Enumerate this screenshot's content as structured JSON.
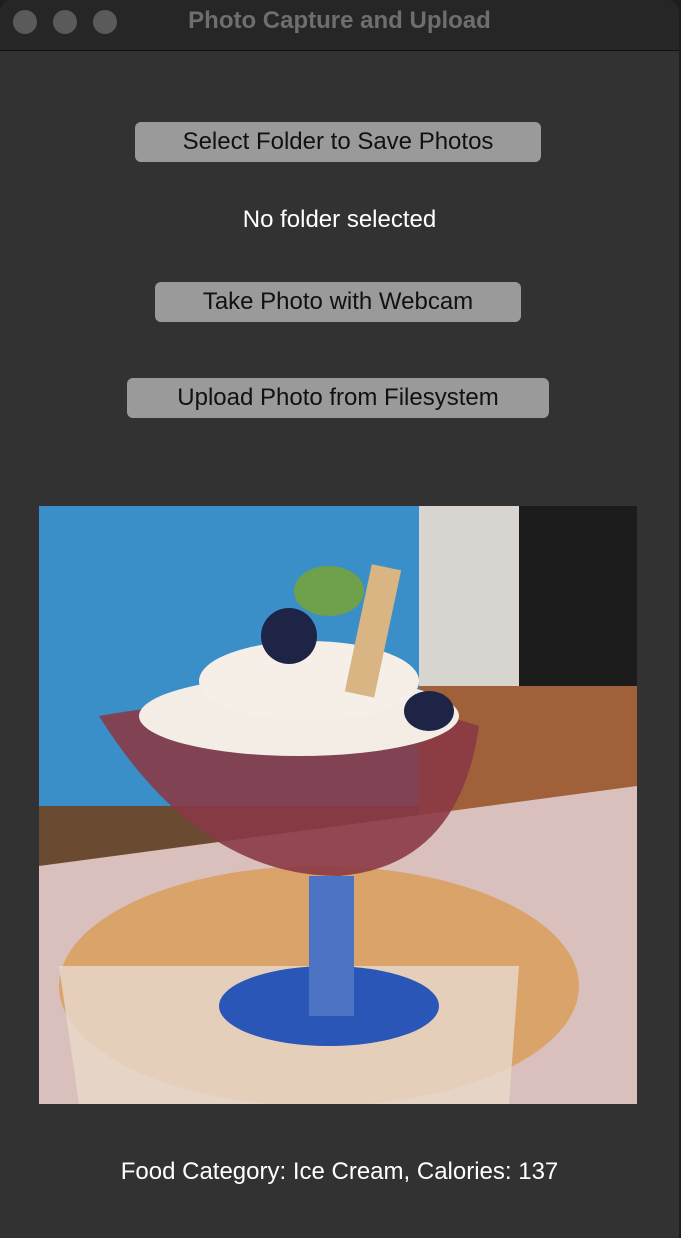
{
  "window": {
    "title": "Photo Capture and Upload"
  },
  "buttons": {
    "select_folder": "Select Folder to Save Photos",
    "take_photo": "Take Photo with Webcam",
    "upload_photo": "Upload Photo from Filesystem"
  },
  "folder_status": "No folder selected",
  "result": "Food Category: Ice Cream, Calories: 137"
}
